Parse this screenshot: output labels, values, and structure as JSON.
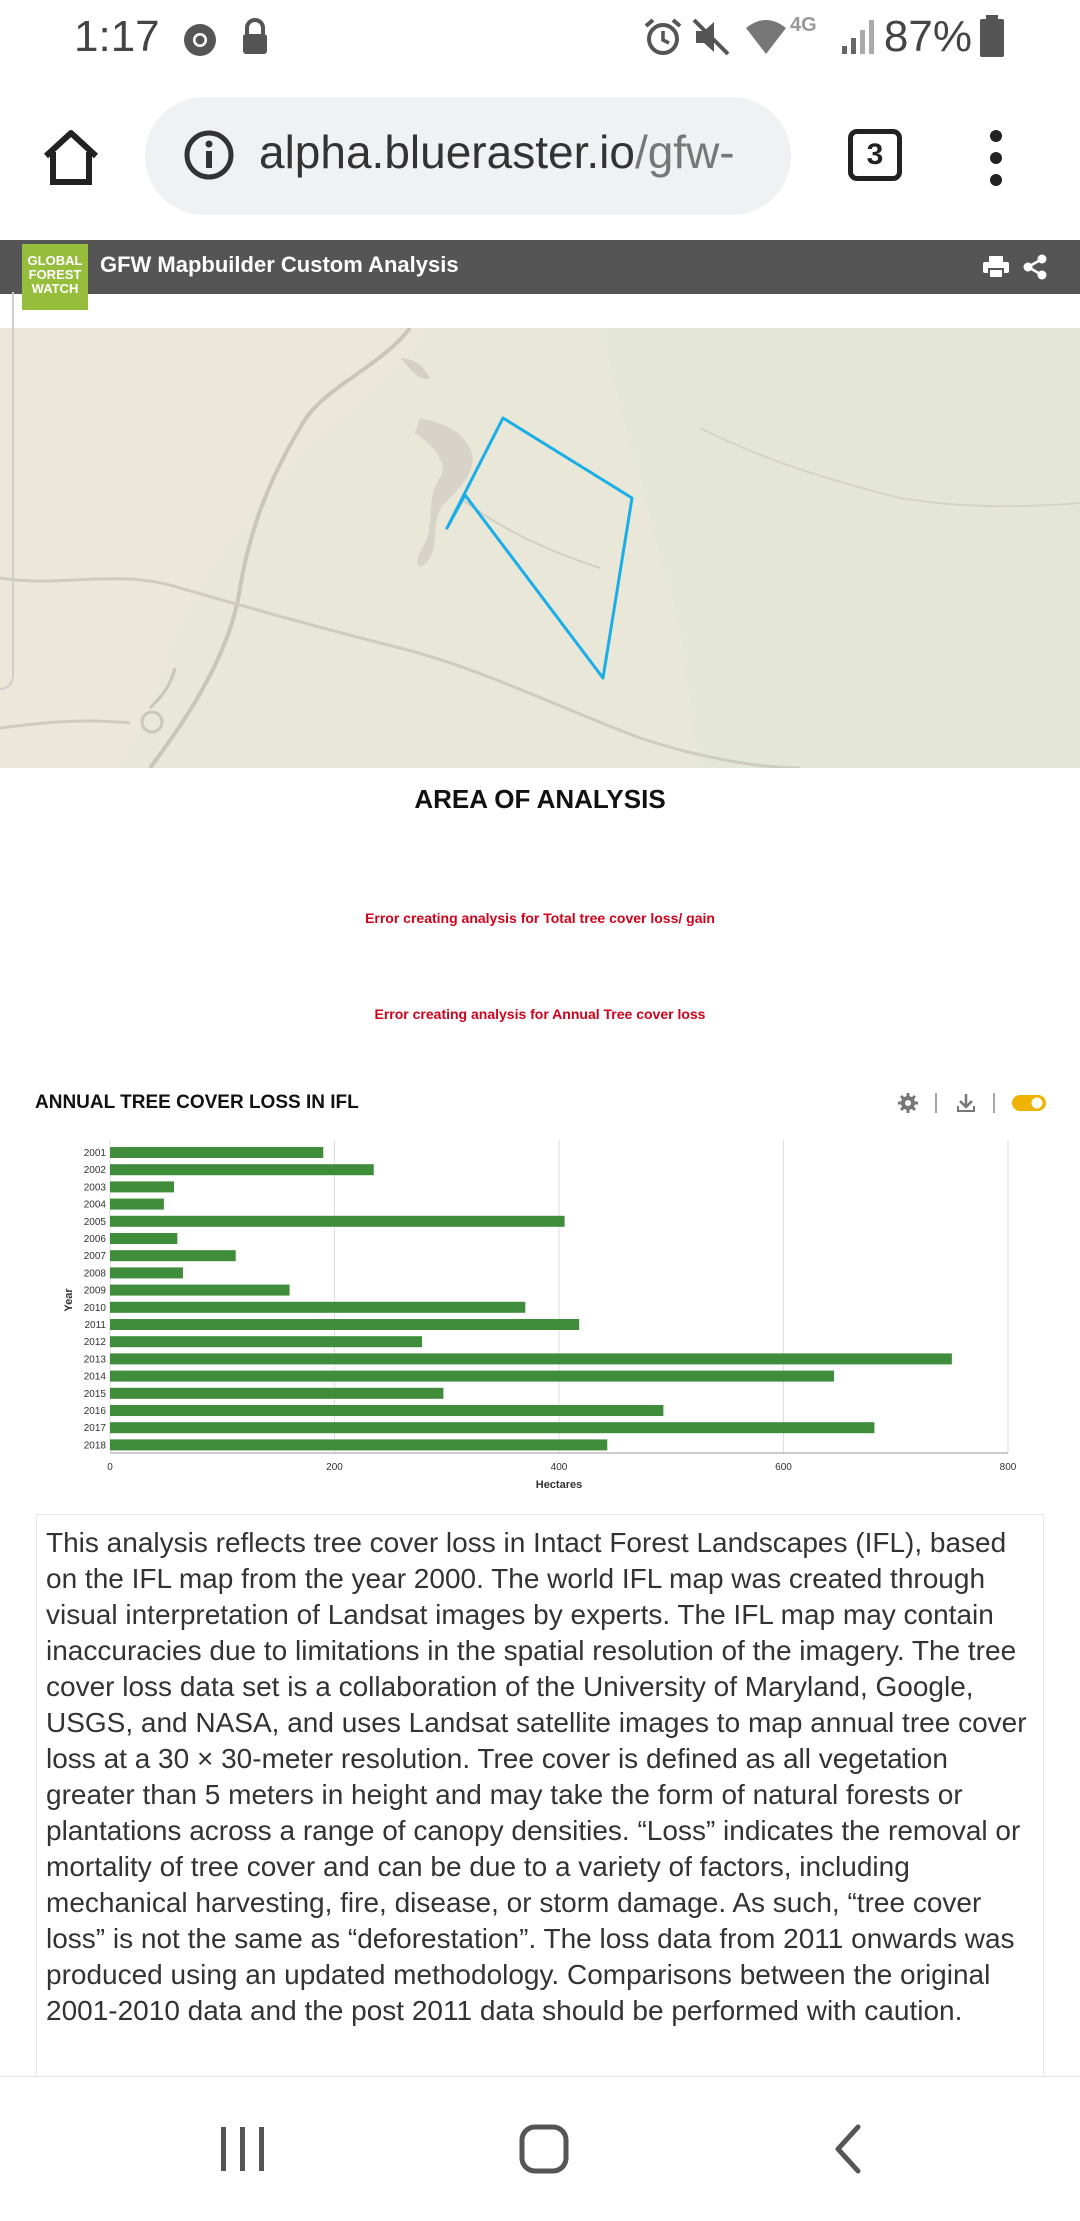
{
  "status_bar": {
    "time": "1:17",
    "network": "4G",
    "battery": "87%",
    "icons": [
      "chrome-icon",
      "lock-icon",
      "alarm-icon",
      "mute-icon",
      "wifi-icon",
      "signal-icon",
      "battery-icon"
    ]
  },
  "browser": {
    "url_main": "alpha.blueraster.io",
    "url_path": "/gfw-",
    "tab_count": "3"
  },
  "app": {
    "logo_line1": "GLOBAL",
    "logo_line2": "FOREST",
    "logo_line3": "WATCH",
    "title": "GFW Mapbuilder Custom Analysis",
    "logo_color": "#97bd3d",
    "header_color": "#555555"
  },
  "analysis": {
    "area_title": "AREA OF ANALYSIS",
    "error_total": "Error creating analysis for Total tree cover loss/ gain",
    "error_annual": "Error creating analysis for Annual Tree cover loss",
    "error_color": "#d0021b",
    "aoi_color": "#1aaee8"
  },
  "chart_section": {
    "title": "ANNUAL TREE COVER LOSS IN IFL",
    "toggle_state": "on",
    "toggle_color": "#f0b400"
  },
  "chart_data": {
    "type": "bar",
    "orientation": "horizontal",
    "categories": [
      "2001",
      "2002",
      "2003",
      "2004",
      "2005",
      "2006",
      "2007",
      "2008",
      "2009",
      "2010",
      "2011",
      "2012",
      "2013",
      "2014",
      "2015",
      "2016",
      "2017",
      "2018"
    ],
    "values": [
      190,
      235,
      57,
      48,
      405,
      60,
      112,
      65,
      160,
      370,
      418,
      278,
      750,
      645,
      297,
      493,
      681,
      443
    ],
    "xlabel": "Hectares",
    "ylabel": "Year",
    "xlim": [
      0,
      800
    ],
    "xticks": [
      "0",
      "200",
      "400",
      "600",
      "800"
    ],
    "bar_color": "#3f8c3b",
    "grid": true
  },
  "description": "This analysis reflects tree cover loss in Intact Forest Landscapes (IFL), based on the IFL map from the year 2000. The world IFL map was created through visual interpretation of Landsat images by experts. The IFL map may contain inaccuracies due to limitations in the spatial resolution of the imagery. The tree cover loss data set is a collaboration of the University of Maryland, Google, USGS, and NASA, and uses Landsat satellite images to map annual tree cover loss at a 30 × 30-meter resolution. Tree cover is defined as all vegetation greater than 5 meters in height and may take the form of natural forests or plantations across a range of canopy densities. “Loss” indicates the removal or mortality of tree cover and can be due to a variety of factors, including mechanical harvesting, fire, disease, or storm damage. As such, “tree cover loss” is not the same as “deforestation”. The loss data from 2011 onwards was produced using an updated methodology. Comparisons between the original 2001-2010 data and the post 2011 data should be performed with caution."
}
